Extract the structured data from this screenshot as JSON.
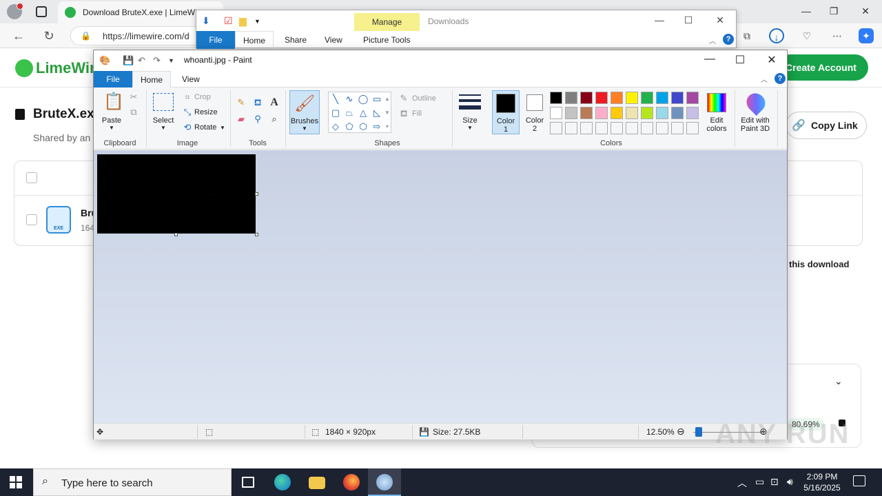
{
  "browser": {
    "tab_title": "Download BruteX.exe | LimeWire",
    "url": "https://limewire.com/d",
    "icons": [
      "profile-icon",
      "tab-actions-icon",
      "back-icon",
      "reload-icon",
      "lock-icon",
      "extensions-icon",
      "download-icon",
      "copilot-icon",
      "more-icon"
    ]
  },
  "limewire": {
    "logo": "LimeWire",
    "create_account": "Create Account",
    "file_name": "BruteX.exe",
    "shared_by": "Shared by an",
    "copy_link": "Copy Link",
    "row_name": "Bru",
    "row_size": "164",
    "exe_badge": "EXE",
    "scan_text": "this download",
    "progress_percent": "80.69%"
  },
  "explorer": {
    "manage_label": "Manage",
    "downloads_label": "Downloads",
    "tabs": [
      "File",
      "Home",
      "Share",
      "View",
      "Picture Tools"
    ],
    "help": "?"
  },
  "paint": {
    "title": "whoanti.jpg - Paint",
    "tabs": {
      "file": "File",
      "home": "Home",
      "view": "View"
    },
    "help": "?",
    "ribbon": {
      "paste": "Paste",
      "clipboard": "Clipboard",
      "select": "Select",
      "crop": "Crop",
      "resize": "Resize",
      "rotate": "Rotate",
      "image": "Image",
      "tools": "Tools",
      "brushes": "Brushes",
      "outline": "Outline",
      "fill": "Fill",
      "shapes": "Shapes",
      "size": "Size",
      "color1": "Color\n1",
      "color1_a": "Color",
      "color1_b": "1",
      "color2_a": "Color",
      "color2_b": "2",
      "colors": "Colors",
      "edit_colors_a": "Edit",
      "edit_colors_b": "colors",
      "paint3d_a": "Edit with",
      "paint3d_b": "Paint 3D"
    },
    "palette": [
      "#000000",
      "#7f7f7f",
      "#880015",
      "#ed1c24",
      "#ff7f27",
      "#fff200",
      "#22b14c",
      "#00a2e8",
      "#3f48cc",
      "#a349a4",
      "#ffffff",
      "#c3c3c3",
      "#b97a57",
      "#ffaec9",
      "#ffc90e",
      "#efe4b0",
      "#b5e61d",
      "#99d9ea",
      "#7092be",
      "#c8bfe7",
      "#f5f6f7",
      "#f5f6f7",
      "#f5f6f7",
      "#f5f6f7",
      "#f5f6f7",
      "#f5f6f7",
      "#f5f6f7",
      "#f5f6f7",
      "#f5f6f7",
      "#f5f6f7"
    ],
    "color1": "#000000",
    "color2": "#ffffff",
    "status": {
      "dimensions": "1840 × 920px",
      "size": "Size: 27.5KB",
      "zoom": "12.50%"
    }
  },
  "watermark": "ANY RUN",
  "taskbar": {
    "search_placeholder": "Type here to search",
    "time": "2:09 PM",
    "date": "5/16/2025"
  }
}
